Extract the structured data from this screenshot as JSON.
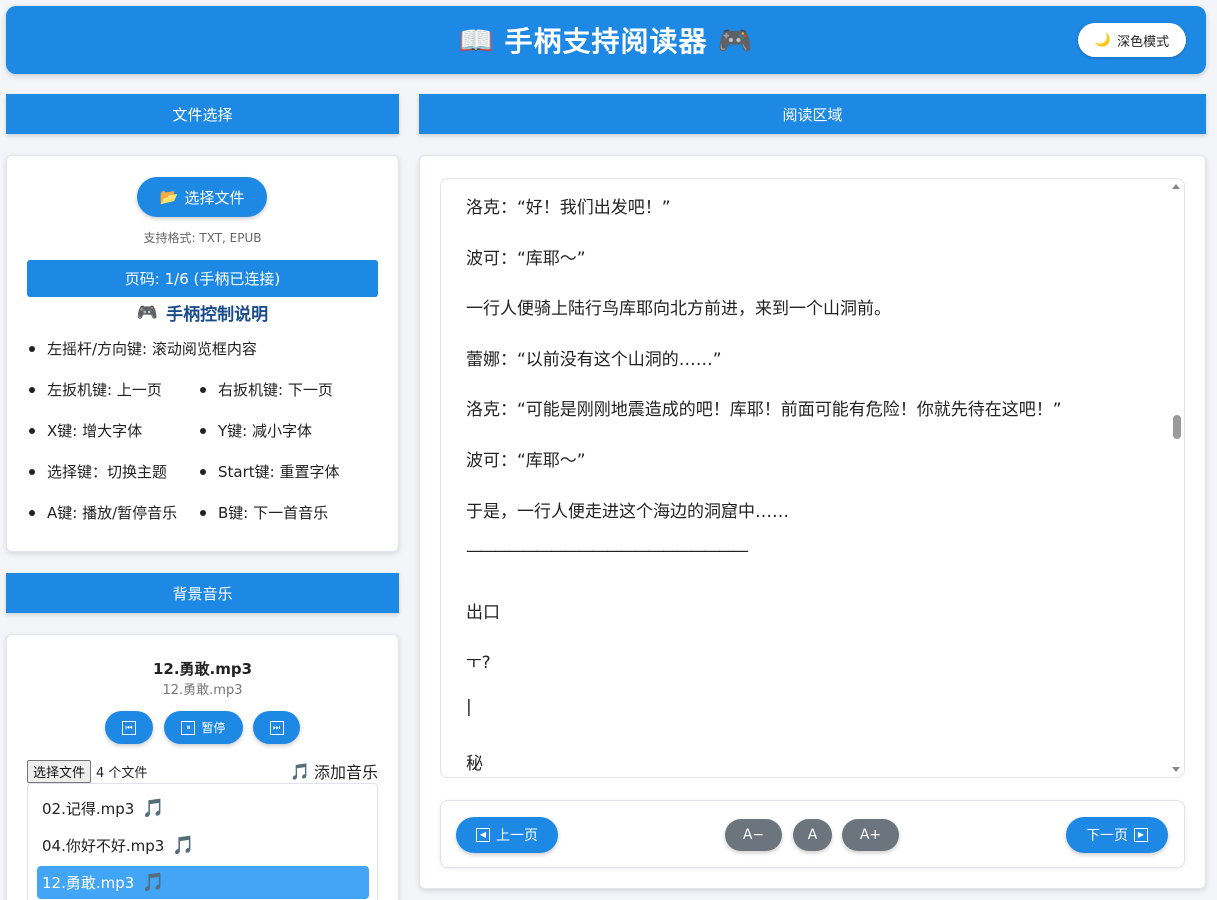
{
  "header": {
    "title": "手柄支持阅读器",
    "book_icon": "📖",
    "gamepad_icon": "🎮",
    "dark_mode_label": "深色模式",
    "dark_mode_icon": "🌙"
  },
  "file_section": {
    "bar_title": "文件选择",
    "choose_file_label": "选择文件",
    "choose_file_icon": "📂",
    "formats_text": "支持格式: TXT, EPUB",
    "page_indicator": "页码: 1/6 (手柄已连接)",
    "controls_title": "手柄控制说明",
    "controls_icon": "🎮",
    "controls": [
      "左摇杆/方向键: 滚动阅览框内容",
      "左扳机键: 上一页",
      "右扳机键: 下一页",
      "X键: 增大字体",
      "Y键: 减小字体",
      "选择键：切换主题",
      "Start键: 重置字体",
      "A键: 播放/暂停音乐",
      "B键: 下一首音乐"
    ]
  },
  "music_section": {
    "bar_title": "背景音乐",
    "current_title": "12.勇敢.mp3",
    "current_sub": "12.勇敢.mp3",
    "prev_icon": "⏮",
    "pause_icon": "⏸",
    "pause_label": "暂停",
    "next_icon": "⏭",
    "file_button": "选择文件",
    "file_count": "4 个文件",
    "add_music_icon": "🎵",
    "add_music_label": "添加音乐",
    "playlist": [
      {
        "name": "02.记得.mp3",
        "active": false
      },
      {
        "name": "04.你好不好.mp3",
        "active": false
      },
      {
        "name": "12.勇敢.mp3",
        "active": true
      }
    ],
    "note_icon": "🎵"
  },
  "reading": {
    "bar_title": "阅读区域",
    "paragraphs": [
      "洛克：“好！我们出发吧！”",
      "波可：“库耶～”",
      "一行人便骑上陆行鸟库耶向北方前进，来到一个山洞前。",
      "蕾娜：“以前没有这个山洞的……”",
      "洛克：“可能是刚刚地震造成的吧！库耶！前面可能有危险！你就先待在这吧！”",
      "波可：“库耶～”",
      "于是，一行人便走进这个海边的洞窟中……",
      "————————————————————",
      "出口",
      "ㅜ?",
      "|",
      "秘"
    ],
    "prev_label": "上一页",
    "next_label": "下一页",
    "font_decrease": "A−",
    "font_reset": "A",
    "font_increase": "A+"
  },
  "colors": {
    "accent": "#1e88e5",
    "active_item": "#42a5f5",
    "font_btn": "#6c757d",
    "title_dark": "#1a4c8c"
  }
}
